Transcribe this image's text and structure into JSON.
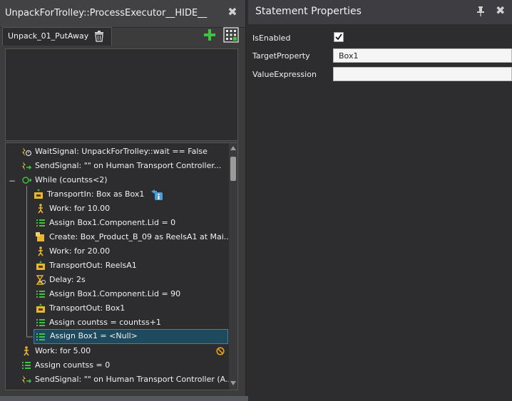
{
  "left_panel": {
    "title": "UnpackForTrolley::ProcessExecutor__HIDE__",
    "close_glyph": "✖",
    "tab_label": "Unpack_01_PutAway"
  },
  "tree": {
    "collapse_glyph": "−",
    "rows": [
      {
        "icon": "wait-signal-icon",
        "label": "WaitSignal: UnpackForTrolley::wait == False"
      },
      {
        "icon": "send-signal-icon",
        "label": "SendSignal: \"\" on Human Transport Controller..."
      },
      {
        "icon": "while-loop-icon",
        "label": "While (countss<2)"
      },
      {
        "icon": "transport-in-icon",
        "label": "TransportIn: Box as Box1"
      },
      {
        "icon": "work-icon",
        "label": "Work: for 10.00"
      },
      {
        "icon": "assign-icon",
        "label": "Assign Box1.Component.Lid = 0"
      },
      {
        "icon": "create-icon",
        "label": "Create: Box_Product_B_09 as ReelsA1 at Mai..."
      },
      {
        "icon": "work-icon",
        "label": "Work: for 20.00"
      },
      {
        "icon": "transport-out-icon",
        "label": "TransportOut: ReelsA1"
      },
      {
        "icon": "delay-icon",
        "label": "Delay: 2s"
      },
      {
        "icon": "assign-icon",
        "label": "Assign Box1.Component.Lid = 90"
      },
      {
        "icon": "transport-out-icon",
        "label": "TransportOut: Box1"
      },
      {
        "icon": "assign-icon",
        "label": "Assign countss = countss+1"
      },
      {
        "icon": "assign-icon",
        "label": "Assign Box1 = <Null>"
      },
      {
        "icon": "work-icon",
        "label": "Work: for 5.00"
      },
      {
        "icon": "assign-icon",
        "label": "Assign countss = 0"
      },
      {
        "icon": "send-signal-icon",
        "label": "SendSignal: \"\" on Human Transport Controller (A..."
      }
    ]
  },
  "right_panel": {
    "title": "Statement Properties",
    "close_glyph": "✖",
    "properties": [
      {
        "name": "IsEnabled",
        "value": ""
      },
      {
        "name": "TargetProperty",
        "value": "Box1"
      },
      {
        "name": "ValueExpression",
        "value": ""
      }
    ]
  },
  "colors": {
    "panel_bg": "#2d2d30",
    "titlebar_bg": "#424245",
    "selection_bg": "#1e4a60",
    "accent_green": "#3ec43e",
    "accent_yellow": "#e8b730"
  }
}
